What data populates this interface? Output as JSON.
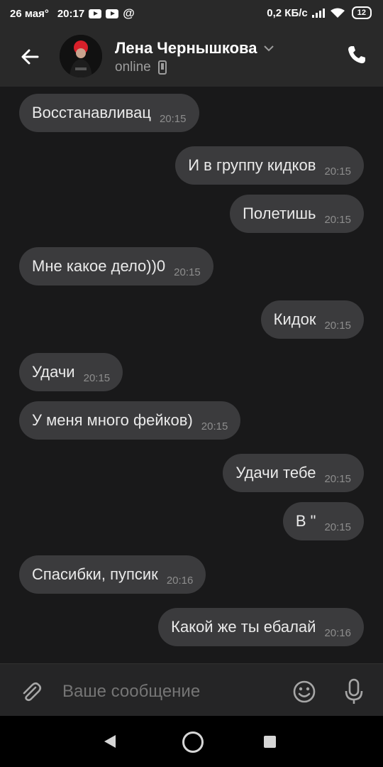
{
  "status_bar": {
    "date": "26 мая°",
    "time": "20:17",
    "icons": [
      "youtube-icon",
      "youtube-icon",
      "at-icon"
    ],
    "net_speed": "0,2 КБ/с",
    "battery": "12"
  },
  "header": {
    "contact_name": "Лена Чернышкова",
    "status": "online",
    "icons": [
      "back-arrow-icon",
      "chevron-down-icon",
      "mobile-icon",
      "phone-icon"
    ]
  },
  "messages": [
    {
      "side": "in",
      "text": "Восстанавливац",
      "time": "20:15"
    },
    {
      "side": "out",
      "text": "И в группу кидков",
      "time": "20:15"
    },
    {
      "side": "out",
      "text": "Полетишь",
      "time": "20:15"
    },
    {
      "side": "in",
      "text": "Мне какое дело))0",
      "time": "20:15"
    },
    {
      "side": "out",
      "text": "Кидок",
      "time": "20:15"
    },
    {
      "side": "in",
      "text": "Удачи",
      "time": "20:15"
    },
    {
      "side": "in",
      "text": "У меня много фейков)",
      "time": "20:15"
    },
    {
      "side": "out",
      "text": "Удачи тебе",
      "time": "20:15"
    },
    {
      "side": "out",
      "text": "В \"",
      "time": "20:15"
    },
    {
      "side": "in",
      "text": "Спасибки, пупсик",
      "time": "20:16"
    },
    {
      "side": "out",
      "text": "Какой же ты ебалай",
      "time": "20:16"
    }
  ],
  "composer": {
    "placeholder": "Ваше сообщение",
    "icons": [
      "paperclip-icon",
      "emoji-icon",
      "microphone-icon"
    ]
  },
  "navbar": {
    "icons": [
      "nav-back-icon",
      "nav-home-icon",
      "nav-recents-icon"
    ]
  },
  "colors": {
    "background": "#19191a",
    "bar": "#292929",
    "bubble": "#3b3b3d"
  }
}
